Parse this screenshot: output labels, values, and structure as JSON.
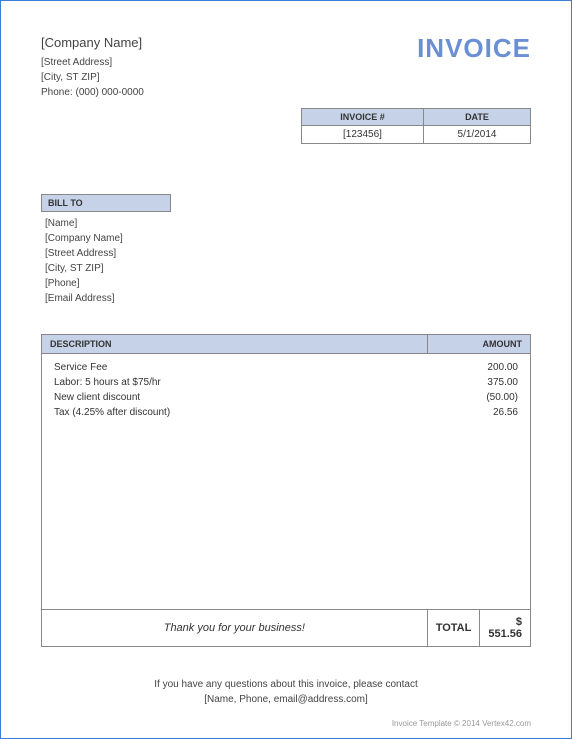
{
  "company": {
    "name": "[Company Name]",
    "street": "[Street Address]",
    "city_st_zip": "[City, ST  ZIP]",
    "phone_label": "Phone:",
    "phone": "(000) 000-0000"
  },
  "title": "INVOICE",
  "meta": {
    "invoice_label": "INVOICE #",
    "invoice_number": "[123456]",
    "date_label": "DATE",
    "date": "5/1/2014"
  },
  "bill_to": {
    "header": "BILL TO",
    "name": "[Name]",
    "company": "[Company Name]",
    "street": "[Street Address]",
    "city_st_zip": "[City, ST  ZIP]",
    "phone": "[Phone]",
    "email": "[Email Address]"
  },
  "columns": {
    "description": "DESCRIPTION",
    "amount": "AMOUNT"
  },
  "items": [
    {
      "description": "Service Fee",
      "amount": "200.00"
    },
    {
      "description": "Labor: 5 hours at $75/hr",
      "amount": "375.00"
    },
    {
      "description": "New client discount",
      "amount": "(50.00)"
    },
    {
      "description": "Tax (4.25% after discount)",
      "amount": "26.56"
    }
  ],
  "thank_you": "Thank you for your business!",
  "total_label": "TOTAL",
  "total_value": "$ 551.56",
  "footer": {
    "line1": "If you have any questions about this invoice, please contact",
    "line2": "[Name, Phone, email@address.com]"
  },
  "fineprint": "Invoice Template © 2014 Vertex42.com"
}
